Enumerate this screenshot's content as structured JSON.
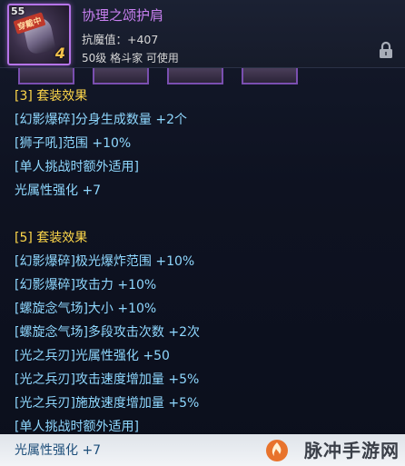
{
  "item": {
    "name": "协理之颂护肩",
    "level_tag": "55",
    "equip_badge": "穿戴中",
    "grade": "4",
    "stat": "抗魔值：+407",
    "requirement": "50级 格斗家 可使用"
  },
  "icons": {
    "item": "shoulder-armor-icon",
    "lock": "lock-icon",
    "watermark_logo": "flame-logo-icon"
  },
  "effects": {
    "set3": {
      "title": "[3] 套装效果",
      "lines": [
        "[幻影爆碎]分身生成数量 +2个",
        "[狮子吼]范围 +10%",
        "[单人挑战时额外适用]",
        "光属性强化 +7"
      ]
    },
    "set5": {
      "title": "[5] 套装效果",
      "lines": [
        "[幻影爆碎]极光爆炸范围 +10%",
        "[幻影爆碎]攻击力 +10%",
        "[螺旋念气场]大小 +10%",
        "[螺旋念气场]多段攻击次数 +2次",
        "[光之兵刃]光属性强化 +50",
        "[光之兵刃]攻击速度增加量 +5%",
        "[光之兵刃]施放速度增加量 +5%",
        "[单人挑战时额外适用]",
        "光属性强化 +7"
      ]
    }
  },
  "watermark": {
    "text": "脉冲手游网"
  },
  "colors": {
    "item_name": "#c880f0",
    "effect_text": "#8fd8ff",
    "effect_title": "#ffd84a",
    "frame": "#b574e8"
  }
}
